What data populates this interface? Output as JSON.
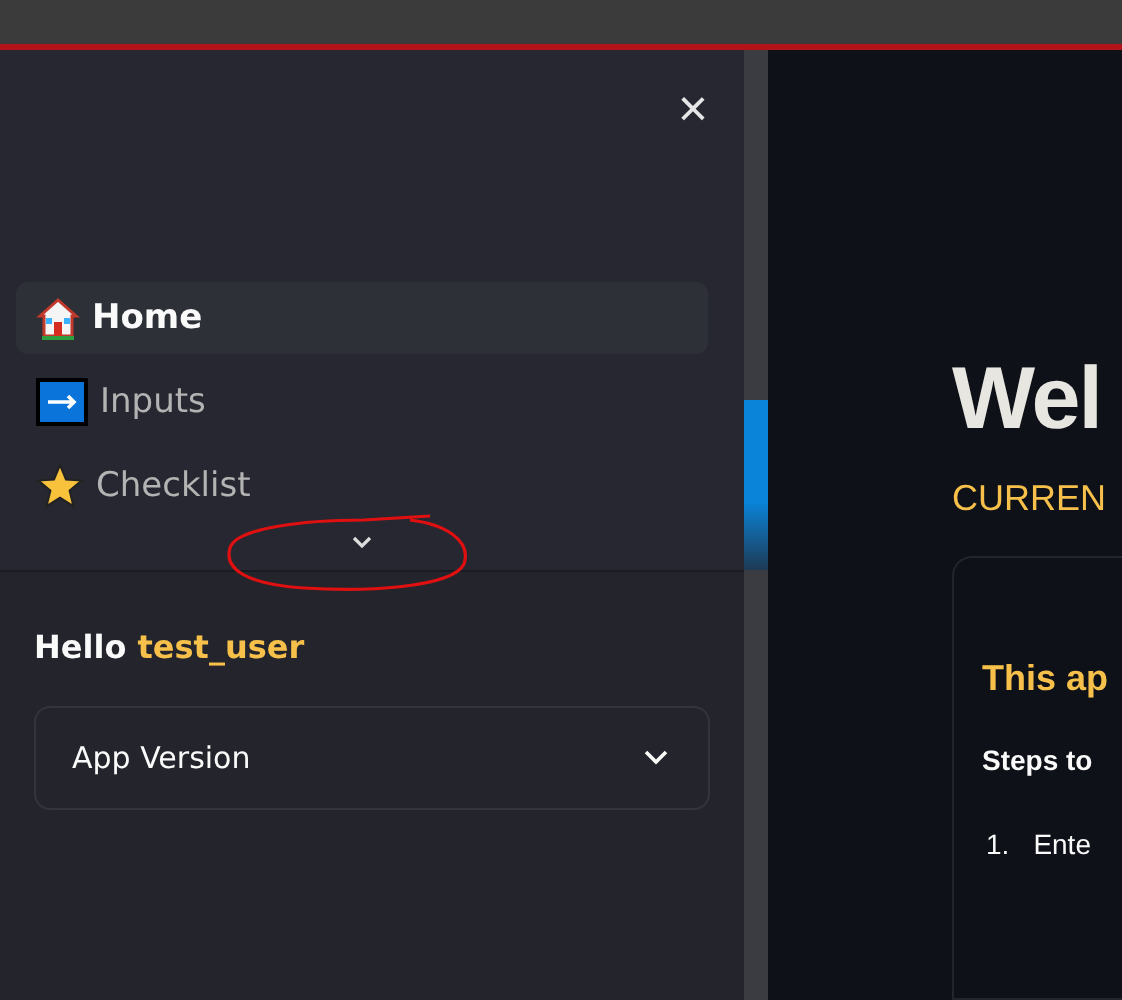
{
  "sidebar": {
    "close": "×",
    "nav": [
      {
        "kind": "house",
        "label": "Home",
        "selected": true
      },
      {
        "kind": "arrow",
        "label": "Inputs",
        "selected": false
      },
      {
        "kind": "star",
        "label": "Checklist",
        "selected": false
      }
    ],
    "greeting": {
      "prefix": "Hello",
      "user": "test_user"
    },
    "expander": {
      "label": "App Version",
      "expanded": false
    }
  },
  "main": {
    "title": "Wel",
    "subtitle": "CURREN",
    "card": {
      "heading": "This ap",
      "steps_label": "Steps to",
      "steps": [
        {
          "number": "1.",
          "text": "Ente"
        }
      ]
    }
  }
}
